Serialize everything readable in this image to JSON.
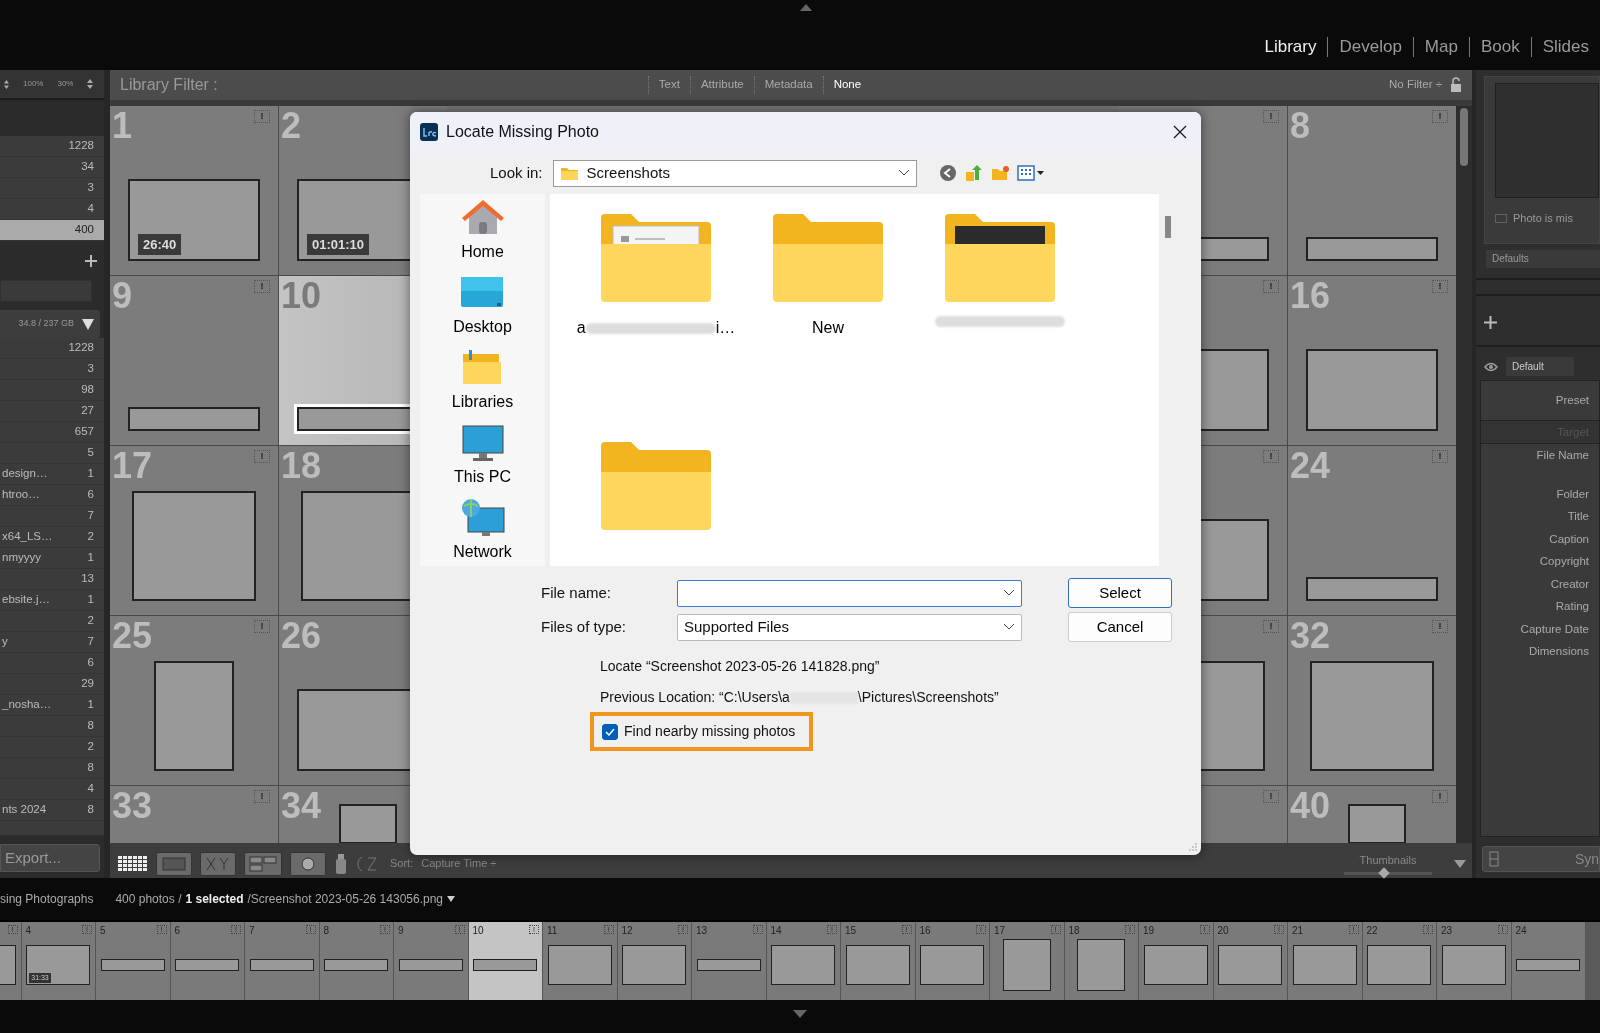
{
  "module_tabs": [
    {
      "label": "Library",
      "selected": true
    },
    {
      "label": "Develop",
      "selected": false
    },
    {
      "label": "Map",
      "selected": false
    },
    {
      "label": "Book",
      "selected": false
    },
    {
      "label": "Slides",
      "selected": false
    }
  ],
  "left_panel": {
    "zoom_options": [
      "100%",
      "30%"
    ],
    "catalog": [
      {
        "count": "1228",
        "selected": false
      },
      {
        "count": "34",
        "selected": false
      },
      {
        "count": "3",
        "selected": false
      },
      {
        "count": "4",
        "selected": false
      },
      {
        "count": "400",
        "selected": true
      }
    ],
    "volume": "34.8 / 237 GB",
    "folders": [
      {
        "count": "1228"
      },
      {
        "count": "3"
      },
      {
        "count": "98"
      },
      {
        "count": "27"
      },
      {
        "count": "657"
      },
      {
        "count": "5"
      },
      {
        "name": "design…",
        "count": "1"
      },
      {
        "name": "htroo…",
        "count": "6"
      },
      {
        "count": "7"
      },
      {
        "name": "x64_LS…",
        "count": "2"
      },
      {
        "name": "nmyyyy",
        "count": "1"
      },
      {
        "count": "13"
      },
      {
        "name": "ebsite.j…",
        "count": "1"
      },
      {
        "count": "2"
      },
      {
        "name": "y",
        "count": "7"
      },
      {
        "count": "6"
      },
      {
        "count": "29"
      },
      {
        "name": "_nosha…",
        "count": "1"
      },
      {
        "count": "8"
      },
      {
        "count": "2"
      },
      {
        "count": "8"
      },
      {
        "count": "4"
      },
      {
        "name": "nts 2024",
        "count": "8"
      }
    ],
    "export_button": "Export..."
  },
  "filter_bar": {
    "title": "Library Filter :",
    "options": [
      {
        "label": "Text",
        "selected": false
      },
      {
        "label": "Attribute",
        "selected": false
      },
      {
        "label": "Metadata",
        "selected": false
      },
      {
        "label": "None",
        "selected": true
      }
    ],
    "preset": "No Filter ÷"
  },
  "grid": {
    "left_cells": [
      {
        "number": "1",
        "kind": "landscape",
        "duration": "26:40",
        "flag": "!",
        "selected": false
      },
      {
        "number": "2",
        "kind": "landscape",
        "duration": "01:01:10",
        "selected": false
      },
      {
        "number": "9",
        "kind": "banner",
        "flag": "!",
        "selected": false
      },
      {
        "number": "10",
        "kind": "banner",
        "selected": true
      },
      {
        "number": "17",
        "kind": "large",
        "flag": "!",
        "selected": false
      },
      {
        "number": "18",
        "kind": "large",
        "selected": false
      },
      {
        "number": "25",
        "kind": "portrait",
        "flag": "!",
        "selected": false
      },
      {
        "number": "26",
        "kind": "landscape",
        "selected": false
      },
      {
        "number": "33",
        "kind": "none",
        "flag": "!",
        "selected": false
      },
      {
        "number": "34",
        "kind": "small",
        "selected": false
      }
    ],
    "right_cells": [
      {
        "kind": "banner",
        "flag": "!",
        "selected": false
      },
      {
        "number": "8",
        "kind": "banner",
        "flag": "!",
        "selected": false
      },
      {
        "kind": "landscape",
        "flag": "!",
        "selected": false
      },
      {
        "number": "16",
        "kind": "landscape",
        "flag": "!",
        "selected": false
      },
      {
        "kind": "landscape",
        "flag": "!",
        "selected": false
      },
      {
        "number": "24",
        "kind": "banner",
        "flag": "!",
        "selected": false
      },
      {
        "kind": "large",
        "flag": "!",
        "selected": false
      },
      {
        "number": "32",
        "kind": "large",
        "flag": "!",
        "selected": false
      },
      {
        "kind": "none",
        "flag": "!",
        "selected": false
      },
      {
        "number": "40",
        "kind": "small",
        "flag": "!",
        "selected": false
      }
    ]
  },
  "toolbar": {
    "sort_label": "Sort:",
    "sort_value": "Capture Time ÷",
    "thumbnail_slider": {
      "label": "Thumbnails",
      "level": 0.45
    }
  },
  "right_panel": {
    "status": "Photo is mis",
    "preset_menu": "Defaults",
    "eye_preset": "Default",
    "preset_label": "Preset",
    "target_label": "Target",
    "fields": [
      "File Name",
      "Folder",
      "Title",
      "Caption",
      "Copyright",
      "Creator",
      "Rating",
      "Capture Date",
      "Dimensions"
    ],
    "sync_button": "Syn"
  },
  "status_bar": {
    "source": "sing Photographs",
    "count": "400 photos /",
    "selection": "1 selected",
    "file": "/Screenshot 2023-05-26 143056.png"
  },
  "filmstrip": [
    {
      "kind": "landscape",
      "flag": "!",
      "selected": false
    },
    {
      "number": "4",
      "kind": "landscape",
      "duration": "31:33",
      "flag": "!",
      "selected": false
    },
    {
      "number": "5",
      "kind": "banner",
      "flag": "!",
      "selected": false
    },
    {
      "number": "6",
      "kind": "banner",
      "flag": "!",
      "selected": false
    },
    {
      "number": "7",
      "kind": "banner",
      "flag": "!",
      "selected": false
    },
    {
      "number": "8",
      "kind": "banner",
      "flag": "!",
      "selected": false
    },
    {
      "number": "9",
      "kind": "banner",
      "flag": "!",
      "selected": false
    },
    {
      "number": "10",
      "kind": "banner",
      "flag": "!",
      "selected": true
    },
    {
      "number": "11",
      "kind": "landscape",
      "flag": "!",
      "selected": false
    },
    {
      "number": "12",
      "kind": "landscape",
      "flag": "!",
      "selected": false
    },
    {
      "number": "13",
      "kind": "banner",
      "flag": "!",
      "selected": false
    },
    {
      "number": "14",
      "kind": "landscape",
      "flag": "!",
      "selected": false
    },
    {
      "number": "15",
      "kind": "landscape",
      "flag": "!",
      "selected": false
    },
    {
      "number": "16",
      "kind": "landscape",
      "flag": "!",
      "selected": false
    },
    {
      "number": "17",
      "kind": "portrait",
      "flag": "!",
      "selected": false
    },
    {
      "number": "18",
      "kind": "portrait",
      "flag": "!",
      "selected": false
    },
    {
      "number": "19",
      "kind": "landscape",
      "flag": "!",
      "selected": false
    },
    {
      "number": "20",
      "kind": "landscape",
      "flag": "!",
      "selected": false
    },
    {
      "number": "21",
      "kind": "landscape",
      "flag": "!",
      "selected": false
    },
    {
      "number": "22",
      "kind": "landscape",
      "flag": "!",
      "selected": false
    },
    {
      "number": "23",
      "kind": "landscape",
      "flag": "!",
      "selected": false
    },
    {
      "number": "24",
      "kind": "banner",
      "selected": false
    }
  ],
  "dialog": {
    "title": "Locate Missing Photo",
    "look_in_label": "Look in:",
    "look_in_value": "Screenshots",
    "places": [
      {
        "label": "Home",
        "kind": "home"
      },
      {
        "label": "Desktop",
        "kind": "desktop"
      },
      {
        "label": "Libraries",
        "kind": "libraries"
      },
      {
        "label": "This PC",
        "kind": "pc"
      },
      {
        "label": "Network",
        "kind": "network"
      }
    ],
    "files": [
      {
        "kind": "document",
        "name_start": "a",
        "name_end": "i…",
        "blurred": true
      },
      {
        "kind": "empty",
        "name": "New",
        "blurred": false
      },
      {
        "kind": "dark",
        "blurred": true
      },
      {
        "kind": "empty"
      }
    ],
    "file_name_label": "File name:",
    "file_type_label": "Files of type:",
    "file_type_value": "Supported Files",
    "buttons": [
      {
        "label": "Select",
        "default": true
      },
      {
        "label": "Cancel",
        "default": false
      }
    ],
    "locate_text": "Locate “Screenshot 2023-05-26 141828.png”",
    "previous_start": "Previous Location: “C:\\Users\\a",
    "previous_end": "\\Pictures\\Screenshots”",
    "find_nearby": {
      "label": "Find nearby missing photos",
      "checked": true,
      "highlighted": true
    }
  }
}
